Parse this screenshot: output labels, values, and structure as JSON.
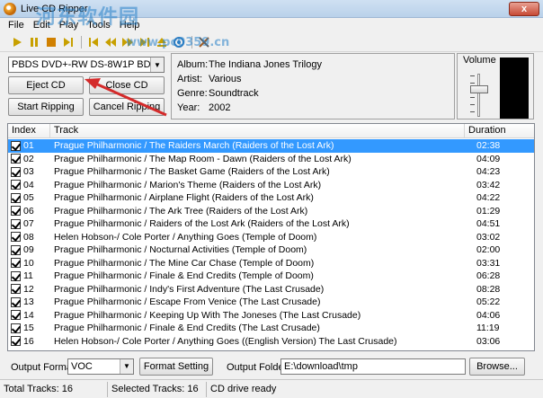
{
  "window": {
    "title": "Live CD Ripper",
    "close_label": "x"
  },
  "menu": [
    "File",
    "Edit",
    "Play",
    "Tools",
    "Help"
  ],
  "toolbar": {
    "icons": [
      "play-icon",
      "pause-icon",
      "stop-icon",
      "next-icon",
      "prev-track-icon",
      "rewind-icon",
      "forward-icon",
      "next-track-icon",
      "eject-icon",
      "record-icon",
      "settings-icon"
    ]
  },
  "drive": {
    "selected": "PBDS DVD+-RW DS-8W1P BD1B"
  },
  "buttons": {
    "eject": "Eject CD",
    "close": "Close CD",
    "start": "Start Ripping",
    "cancel": "Cancel Ripping"
  },
  "album_info": {
    "album_label": "Album:",
    "album": "The Indiana Jones Trilogy",
    "artist_label": "Artist:",
    "artist": "Various",
    "genre_label": "Genre:",
    "genre": "Soundtrack",
    "year_label": "Year:",
    "year": "2002"
  },
  "volume": {
    "label": "Volume",
    "level": 0.7
  },
  "tracklist": {
    "headers": {
      "index": "Index",
      "track": "Track",
      "duration": "Duration"
    },
    "rows": [
      {
        "index": "01",
        "track": "Prague Philharmonic / The Raiders March (Raiders of the Lost Ark)",
        "duration": "02:38",
        "selected": true
      },
      {
        "index": "02",
        "track": "Prague Philharmonic / The Map Room - Dawn (Raiders of the Lost Ark)",
        "duration": "04:09"
      },
      {
        "index": "03",
        "track": "Prague Philharmonic / The Basket Game (Raiders of the Lost Ark)",
        "duration": "04:23"
      },
      {
        "index": "04",
        "track": "Prague Philharmonic / Marion's Theme (Raiders of the Lost Ark)",
        "duration": "03:42"
      },
      {
        "index": "05",
        "track": "Prague Philharmonic / Airplane Flight (Raiders of the Lost Ark)",
        "duration": "04:22"
      },
      {
        "index": "06",
        "track": "Prague Philharmonic / The Ark Tree (Raiders of the Lost Ark)",
        "duration": "01:29"
      },
      {
        "index": "07",
        "track": "Prague Philharmonic / Raiders of the Lost Ark (Raiders of the Lost Ark)",
        "duration": "04:51"
      },
      {
        "index": "08",
        "track": "Helen Hobson-/ Cole Porter / Anything Goes (Temple of Doom)",
        "duration": "03:02"
      },
      {
        "index": "09",
        "track": "Prague Philharmonic / Nocturnal Activities (Temple of Doom)",
        "duration": "02:00"
      },
      {
        "index": "10",
        "track": "Prague Philharmonic / The Mine Car Chase (Temple of Doom)",
        "duration": "03:31"
      },
      {
        "index": "11",
        "track": "Prague Philharmonic / Finale & End Credits (Temple of Doom)",
        "duration": "06:28"
      },
      {
        "index": "12",
        "track": "Prague Philharmonic / Indy's First Adventure (The Last Crusade)",
        "duration": "08:28"
      },
      {
        "index": "13",
        "track": "Prague Philharmonic / Escape From Venice (The Last Crusade)",
        "duration": "05:22"
      },
      {
        "index": "14",
        "track": "Prague Philharmonic / Keeping Up With The Joneses (The Last Crusade)",
        "duration": "04:06"
      },
      {
        "index": "15",
        "track": "Prague Philharmonic / Finale & End Credits (The Last Crusade)",
        "duration": "11:19"
      },
      {
        "index": "16",
        "track": "Helen Hobson-/ Cole Porter / Anything Goes ((English Version) The Last Crusade)",
        "duration": "03:06"
      }
    ]
  },
  "bottom": {
    "format_label": "Output Format",
    "format_value": "VOC",
    "format_setting": "Format Setting",
    "folder_label": "Output Folder",
    "folder_value": "E:\\download\\tmp",
    "browse": "Browse..."
  },
  "status": {
    "total": "Total Tracks: 16",
    "selected": "Selected Tracks: 16",
    "drive": "CD drive ready"
  },
  "watermark": {
    "main": "河东软件园",
    "sub": "www.pc0359.cn"
  },
  "colors": {
    "selection": "#3399ff",
    "annotation_arrow": "#d42a2a"
  }
}
